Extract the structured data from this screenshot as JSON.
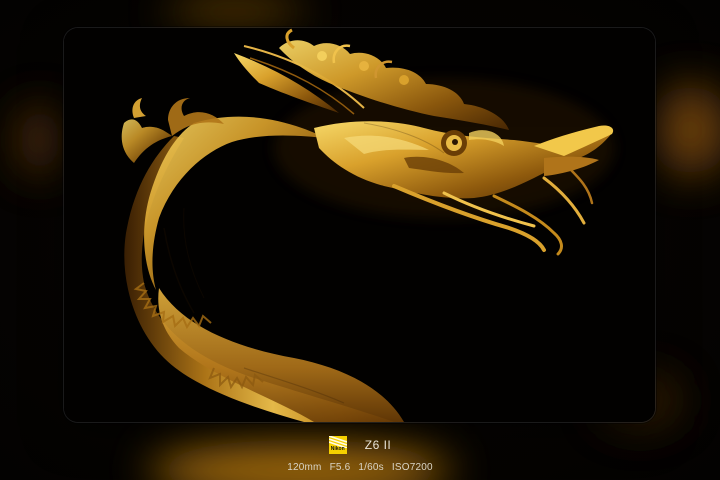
{
  "camera": {
    "brand_logo": "Nikon",
    "model": "Z6 II"
  },
  "exif": {
    "focal_length": "120mm",
    "aperture": "F5.6",
    "shutter": "1/60s",
    "iso": "ISO7200"
  },
  "colors": {
    "background": "#050302",
    "gold_highlight": "#f2c84a",
    "gold_mid": "#c58a1c",
    "gold_dark": "#5a3205",
    "logo_yellow": "#f5d000"
  },
  "icons": [
    "nikon-logo-icon"
  ]
}
